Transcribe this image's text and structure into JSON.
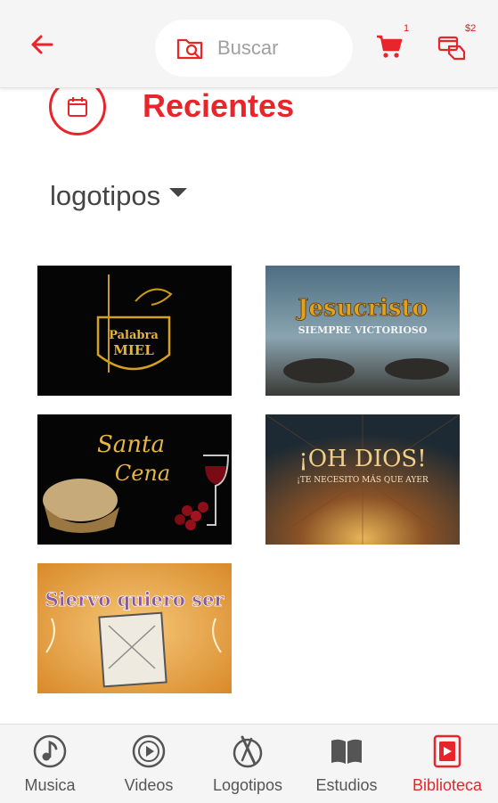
{
  "header": {
    "search_placeholder": "Buscar",
    "cart_count": "1",
    "wallet_amount": "$2"
  },
  "section": {
    "title": "Recientes"
  },
  "filter": {
    "selected": "logotipos"
  },
  "thumbnails": [
    {
      "title_lines": [
        "Palabra",
        "MIEL"
      ]
    },
    {
      "title_lines": [
        "Jesucristo",
        "SIEMPRE VICTORIOSO"
      ]
    },
    {
      "title_lines": [
        "Santa",
        "Cena"
      ]
    },
    {
      "title_lines": [
        "¡OH DIOS!",
        "¡TE NECESITO MÁS QUE AYER"
      ]
    },
    {
      "title_lines": [
        "Siervo quiero ser"
      ]
    }
  ],
  "bottom_nav": {
    "items": [
      {
        "label": "Musica"
      },
      {
        "label": "Videos"
      },
      {
        "label": "Logotipos"
      },
      {
        "label": "Estudios"
      },
      {
        "label": "Biblioteca"
      }
    ],
    "active_index": 4
  },
  "colors": {
    "accent": "#e8252b",
    "bar_background": "#f5f5f5"
  }
}
